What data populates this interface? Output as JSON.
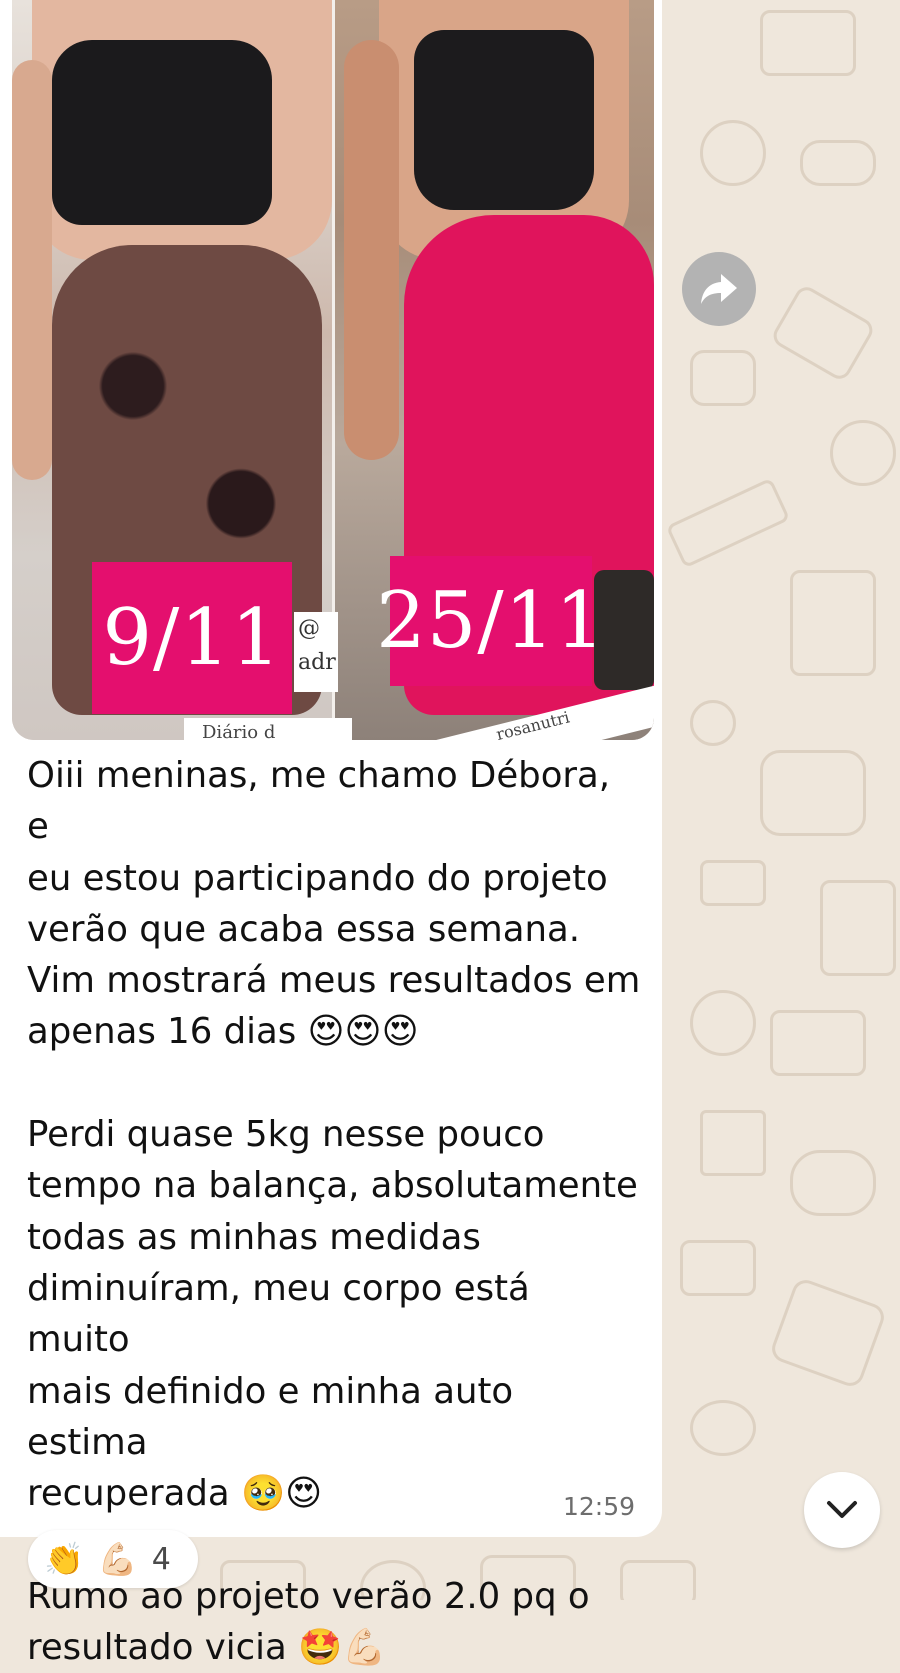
{
  "message": {
    "photo": {
      "left_date_label": "9/11",
      "right_date_label": "25/11",
      "overlay_text_left_top": "@",
      "overlay_text_left_bottom": "adr",
      "overlay_text_bottom": "Diário d",
      "overlay_text_right": "rosanutri"
    },
    "text": "Oiii meninas, me chamo Débora, e\neu estou participando do projeto\nverão que acaba essa semana.\nVim mostrará meus resultados em\napenas 16 dias 😍😍😍\n\nPerdi quase 5kg nesse pouco\ntempo na balança, absolutamente\ntodas as minhas medidas\ndiminuíram, meu corpo está muito\nmais definido e minha auto estima\nrecuperada 🥹😍\n\nRumo ao projeto verão 2.0 pq o\nresultado vicia 🤩💪🏻",
    "timestamp": "12:59"
  },
  "reactions": {
    "emoji_1": "👏",
    "emoji_2": "💪🏻",
    "count": "4"
  },
  "icons": {
    "forward": "forward-arrow-icon",
    "scroll": "chevron-down-icon"
  },
  "colors": {
    "chat_background": "#efe7dc",
    "bubble": "#ffffff",
    "date_label": "#e40f6e",
    "forward_button": "#b3b3b3"
  }
}
